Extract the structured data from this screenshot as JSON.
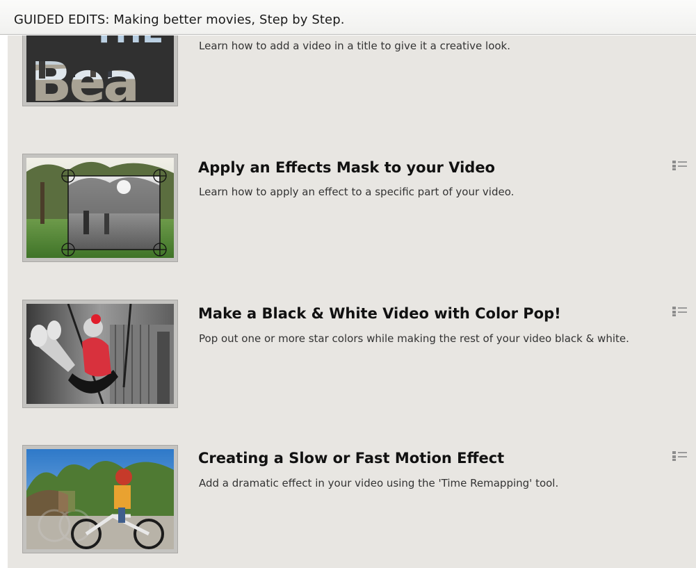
{
  "header": {
    "title": "GUIDED EDITS: Making better movies, Step by Step."
  },
  "items": [
    {
      "title": "",
      "description": "Learn how to add a video in a title to give it a creative look.",
      "thumbnail": "video-in-title-thumbnail",
      "thumbnail_text": "THE Bea"
    },
    {
      "title": "Apply an Effects Mask to your Video",
      "description": "Learn how to apply an effect to a specific part of your video.",
      "thumbnail": "effects-mask-thumbnail",
      "options_icon": "list-options-icon"
    },
    {
      "title": "Make a Black & White Video with Color Pop!",
      "description": "Pop out one or more star colors while making the rest of your video black & white.",
      "thumbnail": "color-pop-thumbnail",
      "options_icon": "list-options-icon"
    },
    {
      "title": "Creating a Slow or Fast Motion Effect",
      "description": "Add a dramatic effect in your video using the 'Time Remapping' tool.",
      "thumbnail": "motion-effect-thumbnail",
      "options_icon": "list-options-icon"
    }
  ],
  "colors": {
    "panel_background": "#e8e6e2",
    "thumbnail_frame": "#c4c3c0",
    "title_text": "#111111",
    "description_text": "#333333"
  }
}
